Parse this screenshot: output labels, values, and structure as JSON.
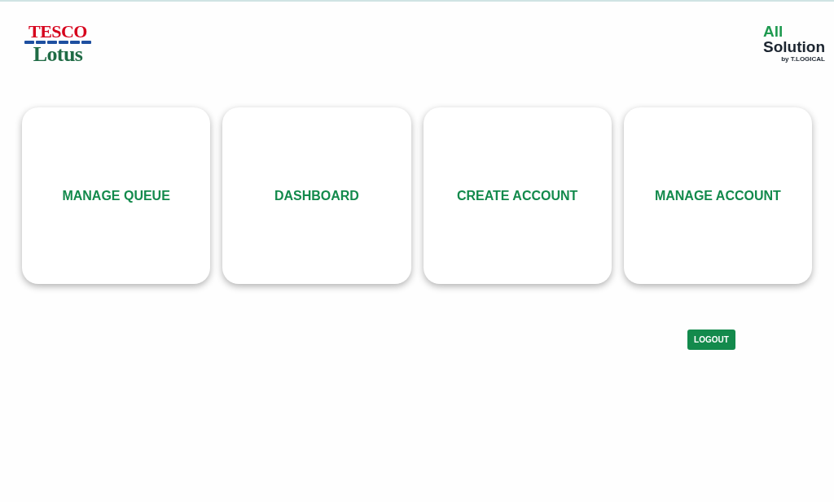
{
  "brand_left": {
    "line_1": "TESCO",
    "line_2": "Lotus"
  },
  "brand_right": {
    "line_1": "All",
    "line_2": "Solution",
    "line_3": "by T.LOGICAL"
  },
  "tiles": [
    {
      "label": "MANAGE QUEUE"
    },
    {
      "label": "DASHBOARD"
    },
    {
      "label": "CREATE ACCOUNT"
    },
    {
      "label": "MANAGE ACCOUNT"
    }
  ],
  "logout_button": "LOGOUT"
}
